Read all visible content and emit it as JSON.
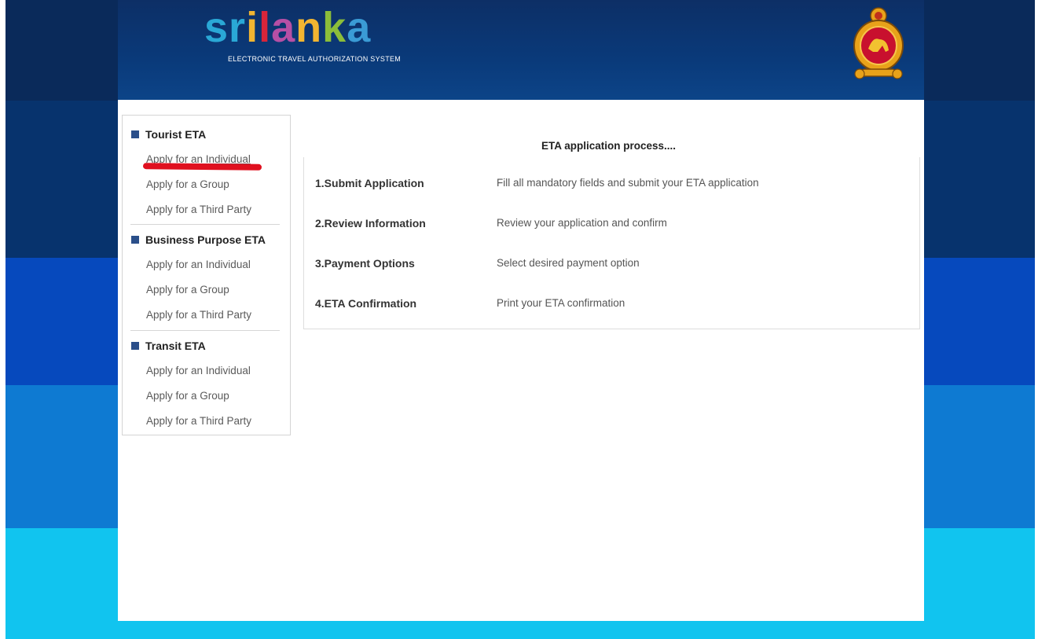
{
  "header": {
    "logo_word": "srilanka",
    "logo_subtitle": "ELECTRONIC TRAVEL AUTHORIZATION SYSTEM",
    "emblem_icon": "sri-lanka-emblem-icon"
  },
  "sidebar": {
    "sections": [
      {
        "title": "Tourist ETA",
        "links": [
          "Apply for an Individual",
          "Apply for a Group",
          "Apply for a Third Party"
        ]
      },
      {
        "title": "Business Purpose ETA",
        "links": [
          "Apply for an Individual",
          "Apply for a Group",
          "Apply for a Third Party"
        ]
      },
      {
        "title": "Transit ETA",
        "links": [
          "Apply for an Individual",
          "Apply for a Group",
          "Apply for a Third Party"
        ]
      }
    ]
  },
  "main": {
    "title": "ETA application process....",
    "steps": [
      {
        "name": "1.Submit Application",
        "desc": "Fill all mandatory fields and submit your ETA application"
      },
      {
        "name": "2.Review Information",
        "desc": "Review your application and confirm"
      },
      {
        "name": "3.Payment Options",
        "desc": "Select desired payment option"
      },
      {
        "name": "4.ETA Confirmation",
        "desc": "Print your ETA confirmation"
      }
    ]
  },
  "colors": {
    "header_bg": "#0d2f66",
    "bullet": "#2b4f8a",
    "highlight_mark": "#e0101f"
  }
}
